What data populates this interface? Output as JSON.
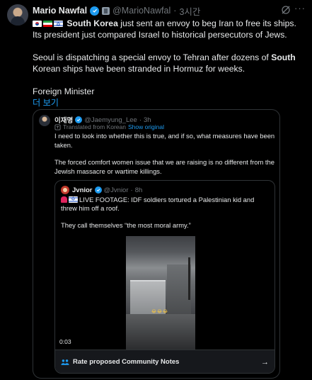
{
  "post": {
    "author_name": "Mario Nawfal",
    "handle": "@MarioNawfal",
    "separator": "·",
    "time": "3시간",
    "line1_bold": "South Korea",
    "line1_rest": " just sent an envoy to beg Iran to free its ships. Its president just compared Israel to historical persecutors of Jews.",
    "para2_a": "Seoul is dispatching a special envoy to Tehran after dozens of ",
    "para2_bold": "South",
    "para2_b": " Korean ships have been stranded in Hormuz for weeks.",
    "para3": "Foreign Minister",
    "show_more": "더 보기",
    "more_icon": "···",
    "grok_icon": "grok-icon"
  },
  "quote": {
    "author_name": "이재명",
    "handle": "@Jaemyung_Lee",
    "separator": "·",
    "time": "3h",
    "translated_label": "Translated from Korean",
    "show_original": "Show original",
    "para1": "I need to look into whether this is true, and if so, what measures have been taken.",
    "para2": "The forced comfort women issue that we are raising is no different from the Jewish massacre or wartime killings."
  },
  "inner_quote": {
    "author_name": "Jvnior",
    "handle": "@Jvnior",
    "separator": "·",
    "time": "8h",
    "line1": "LIVE FOOTAGE: IDF soldiers tortured a Palestinian kid and threw him off a roof.",
    "line2": "They call themselves “the most moral army.”",
    "video_caption": "😂😂😂",
    "video_timestamp": "0:03"
  },
  "community_notes": {
    "label": "Rate proposed Community Notes",
    "arrow": "→"
  },
  "colors": {
    "background": "#000000",
    "text": "#e7e9ea",
    "muted": "#71767b",
    "link": "#1d9bf0",
    "border": "#2f3336",
    "notes_bg": "#16181c"
  }
}
